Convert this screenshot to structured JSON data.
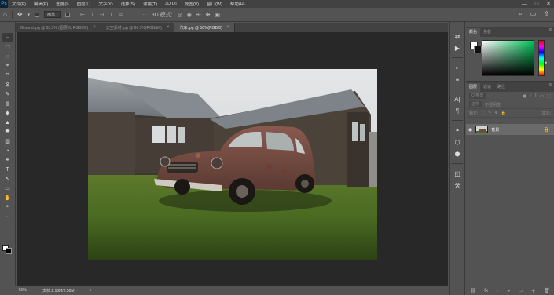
{
  "menubar": {
    "logo": "Ps",
    "items": [
      "文件(F)",
      "编辑(E)",
      "图像(I)",
      "图层(L)",
      "文字(Y)",
      "选择(S)",
      "滤镜(T)",
      "3D(D)",
      "视图(V)",
      "窗口(W)",
      "帮助(H)"
    ],
    "window_controls": [
      "—",
      "□",
      "✕"
    ]
  },
  "options": {
    "mode_select": "画笔",
    "extra_icon": "···"
  },
  "tabs": [
    {
      "label": "Ground.jpg @ 33.3% (图层 0, RGB/8#)",
      "close": "×"
    },
    {
      "label": "天空素材.jpg @ 66.7%(RGB/8#)",
      "close": "×"
    },
    {
      "label": "汽车.jpg @ 50%(RGB/8)",
      "close": "×"
    }
  ],
  "status": {
    "zoom": "50%",
    "doc_info": "文档:2.58M/2.58M",
    "arrow": "›"
  },
  "color_panel": {
    "tabs": [
      "颜色",
      "色板"
    ],
    "menu": "≡"
  },
  "layers_panel": {
    "tabs": [
      "图层",
      "通道",
      "路径"
    ],
    "menu": "≡",
    "kind_filter": "Q 类型",
    "blend_mode": "正常",
    "opacity_label": "不透明度:",
    "lock_label": "锁定:",
    "fill_label": "填充:",
    "layer_name": "背景",
    "footer_icons": [
      "⛓",
      "fx",
      "◐",
      "◑",
      "▭",
      "＋",
      "🗑"
    ]
  },
  "toolbar_icons": [
    "⇔",
    "⬚",
    "◌",
    "⌖",
    "⌗",
    "⊠",
    "✎",
    "◍",
    "⧫",
    "▲",
    "⬬",
    "▧",
    "◔",
    "✒",
    "T",
    "↖",
    "▭",
    "✋",
    "⌕",
    "···"
  ],
  "strip_icons": [
    "⇄",
    "▶",
    "◐",
    "≡",
    "A|",
    "¶",
    "◓",
    "⬡",
    "⬢",
    "◱",
    "⚒"
  ]
}
